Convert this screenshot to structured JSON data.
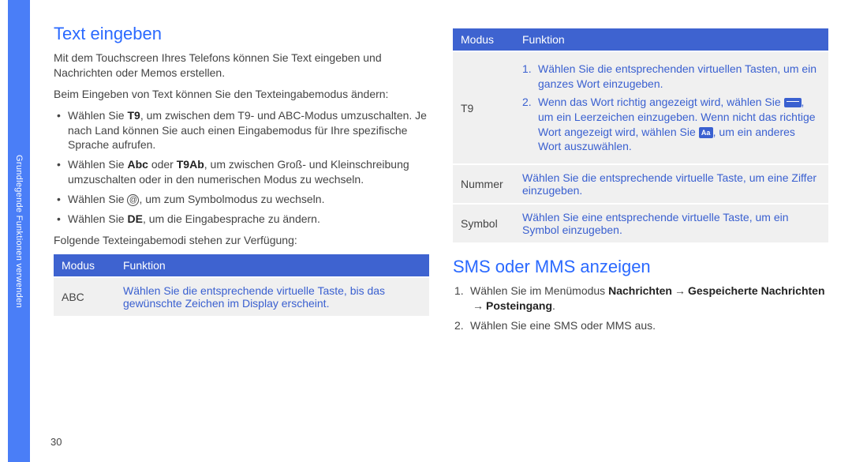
{
  "sidebar": {
    "label": "Grundlegende Funktionen verwenden"
  },
  "page_number": "30",
  "left": {
    "heading": "Text eingeben",
    "intro": "Mit dem Touchscreen Ihres Telefons können Sie Text eingeben und Nachrichten oder Memos erstellen.",
    "mode_note": "Beim Eingeben von Text können Sie den Texteingabemodus ändern:",
    "bullets": {
      "b1a": "Wählen Sie ",
      "b1_bold": "T9",
      "b1b": ", um zwischen dem T9- und ABC-Modus umzuschalten. Je nach Land können Sie auch einen Eingabemodus für Ihre spezifische Sprache aufrufen.",
      "b2a": "Wählen Sie ",
      "b2_bold1": "Abc",
      "b2_mid": " oder ",
      "b2_bold2": "T9Ab",
      "b2b": ", um zwischen Groß- und Kleinschreibung umzuschalten oder in den numerischen Modus zu wechseln.",
      "b3a": "Wählen Sie ",
      "b3b": ", um zum Symbolmodus zu wechseln.",
      "b4a": "Wählen Sie ",
      "b4_bold": "DE",
      "b4b": ", um die Eingabesprache zu ändern."
    },
    "available": "Folgende Texteingabemodi stehen zur Verfügung:",
    "table": {
      "h1": "Modus",
      "h2": "Funktion",
      "r1_mode": "ABC",
      "r1_func": "Wählen Sie die entsprechende virtuelle Taste, bis das gewünschte Zeichen im Display erscheint."
    }
  },
  "right": {
    "table": {
      "h1": "Modus",
      "h2": "Funktion",
      "r1_mode": "T9",
      "r1_s1": "Wählen Sie die entsprechenden virtuellen Tasten, um ein ganzes Wort einzugeben.",
      "r1_s2a": "Wenn das Wort richtig angezeigt wird, wählen Sie ",
      "r1_s2b": ", um ein Leerzeichen einzugeben. Wenn nicht das richtige Wort angezeigt wird, wählen Sie ",
      "r1_s2c": ", um ein anderes Wort auszuwählen.",
      "r2_mode": "Nummer",
      "r2_func": "Wählen Sie die entsprechende virtuelle Taste, um eine Ziffer einzugeben.",
      "r3_mode": "Symbol",
      "r3_func": "Wählen Sie eine entsprechende virtuelle Taste, um ein Symbol einzugeben."
    },
    "heading": "SMS oder MMS anzeigen",
    "s1a": "Wählen Sie im Menümodus ",
    "s1_bold1": "Nachrichten",
    "s1_bold2": "Gespeicherte Nachrichten",
    "s1_bold3": "Posteingang",
    "s1_dot": ".",
    "s2": "Wählen Sie eine SMS oder MMS aus.",
    "arrow": "→"
  },
  "icons": {
    "at": "@",
    "aa": "Aa"
  }
}
